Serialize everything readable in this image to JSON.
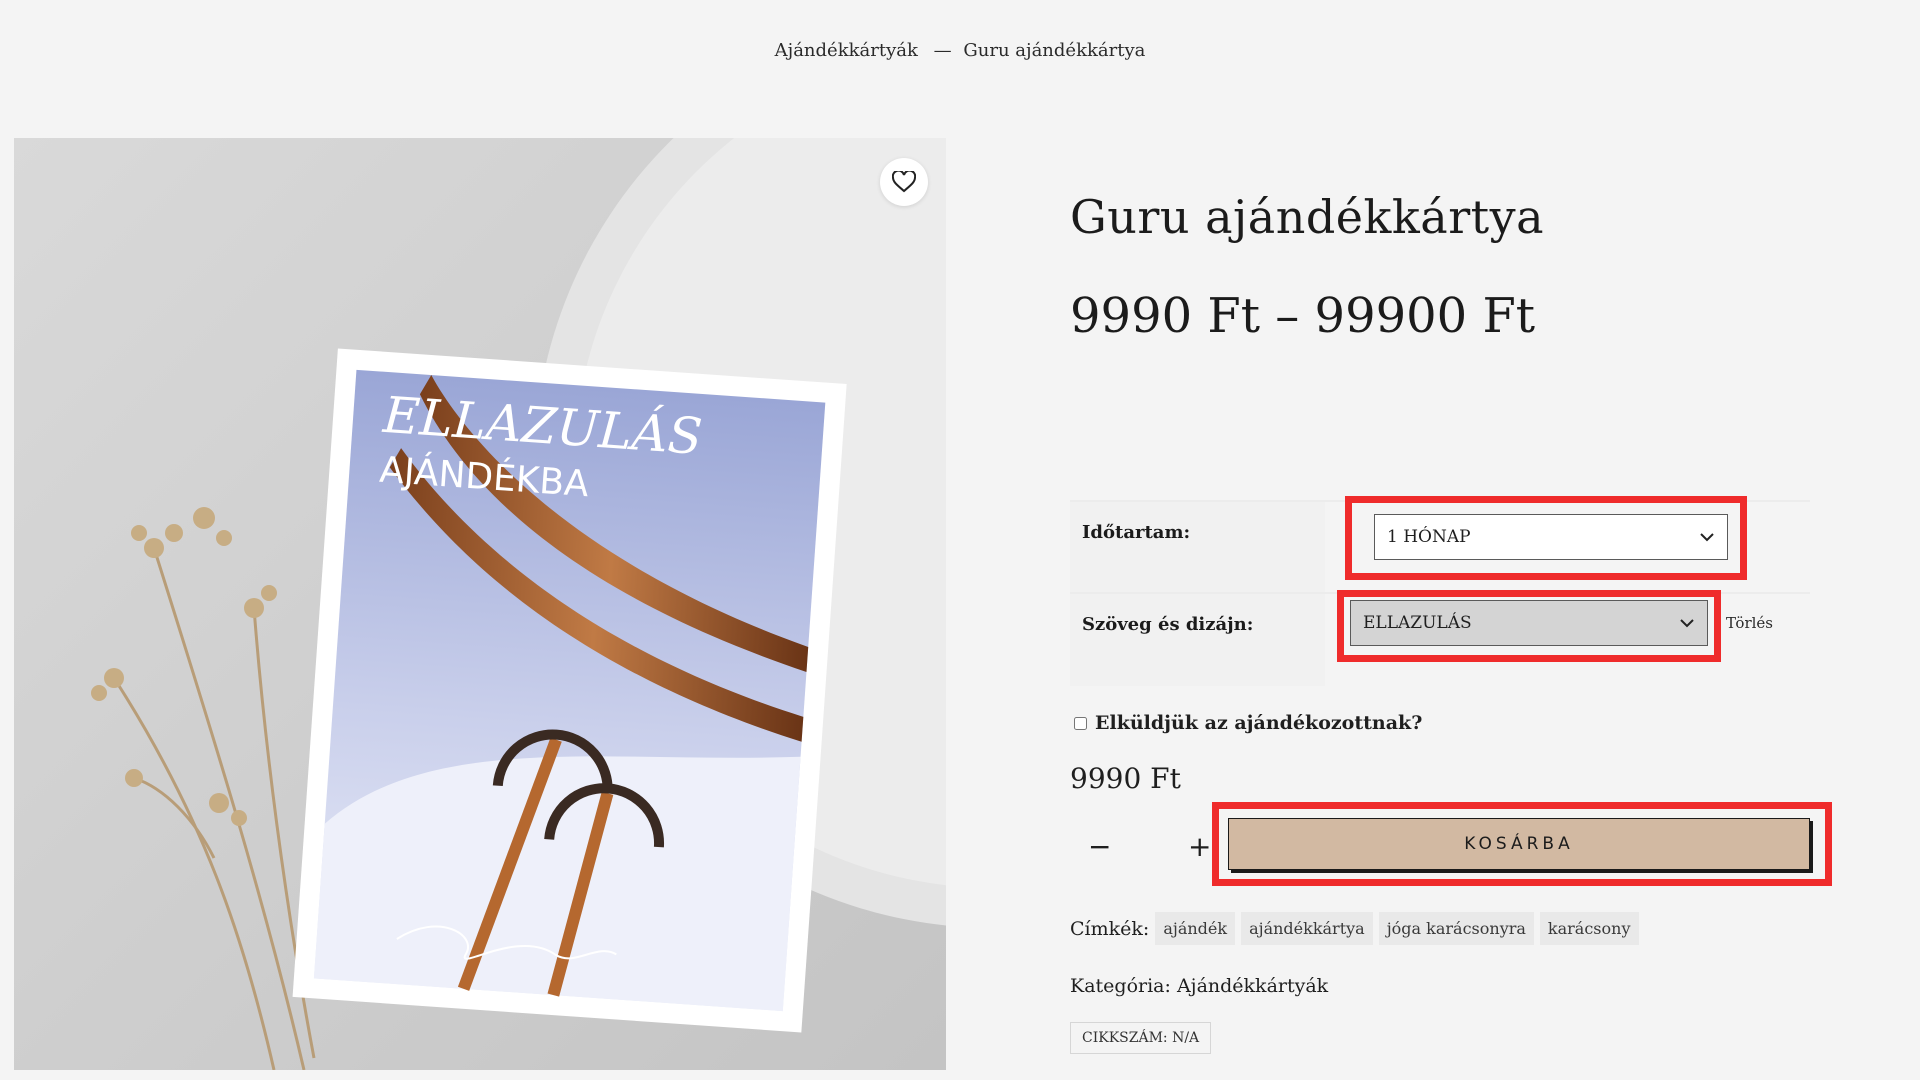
{
  "breadcrumb": {
    "parent": "Ajándékkártyák",
    "separator": "—",
    "current": "Guru ajándékkártya"
  },
  "product": {
    "title": "Guru ajándékkártya",
    "price_range": "9990 Ft – 99900 Ft",
    "card_text_line1": "ELLAZULÁS",
    "card_text_line2": "AJÁNDÉKBA"
  },
  "variations": {
    "duration_label": "Időtartam:",
    "duration_value": "1 HÓNAP",
    "design_label": "Szöveg és dizájn:",
    "design_value": "ELLAZULÁS",
    "reset_label": "Törlés"
  },
  "send_gift": {
    "label": "Elküldjük az ajándékozottnak?"
  },
  "variation_price": "9990 Ft",
  "quantity": {
    "minus": "−",
    "plus": "+",
    "value": ""
  },
  "cart": {
    "button_label": "KOSÁRBA"
  },
  "meta": {
    "tags_label": "Címkék:",
    "tags": [
      "ajándék",
      "ajándékkártya",
      "jóga karácsonyra",
      "karácsony"
    ],
    "category_label": "Kategória:",
    "category_value": "Ajándékkártyák",
    "sku": "CIKKSZÁM: N/A"
  },
  "icons": {
    "wishlist": "heart-icon",
    "dropdown": "chevron-down-icon"
  },
  "colors": {
    "highlight": "#ef2b2b",
    "cart_button": "#d2b9a2",
    "background": "#f4f4f4"
  }
}
